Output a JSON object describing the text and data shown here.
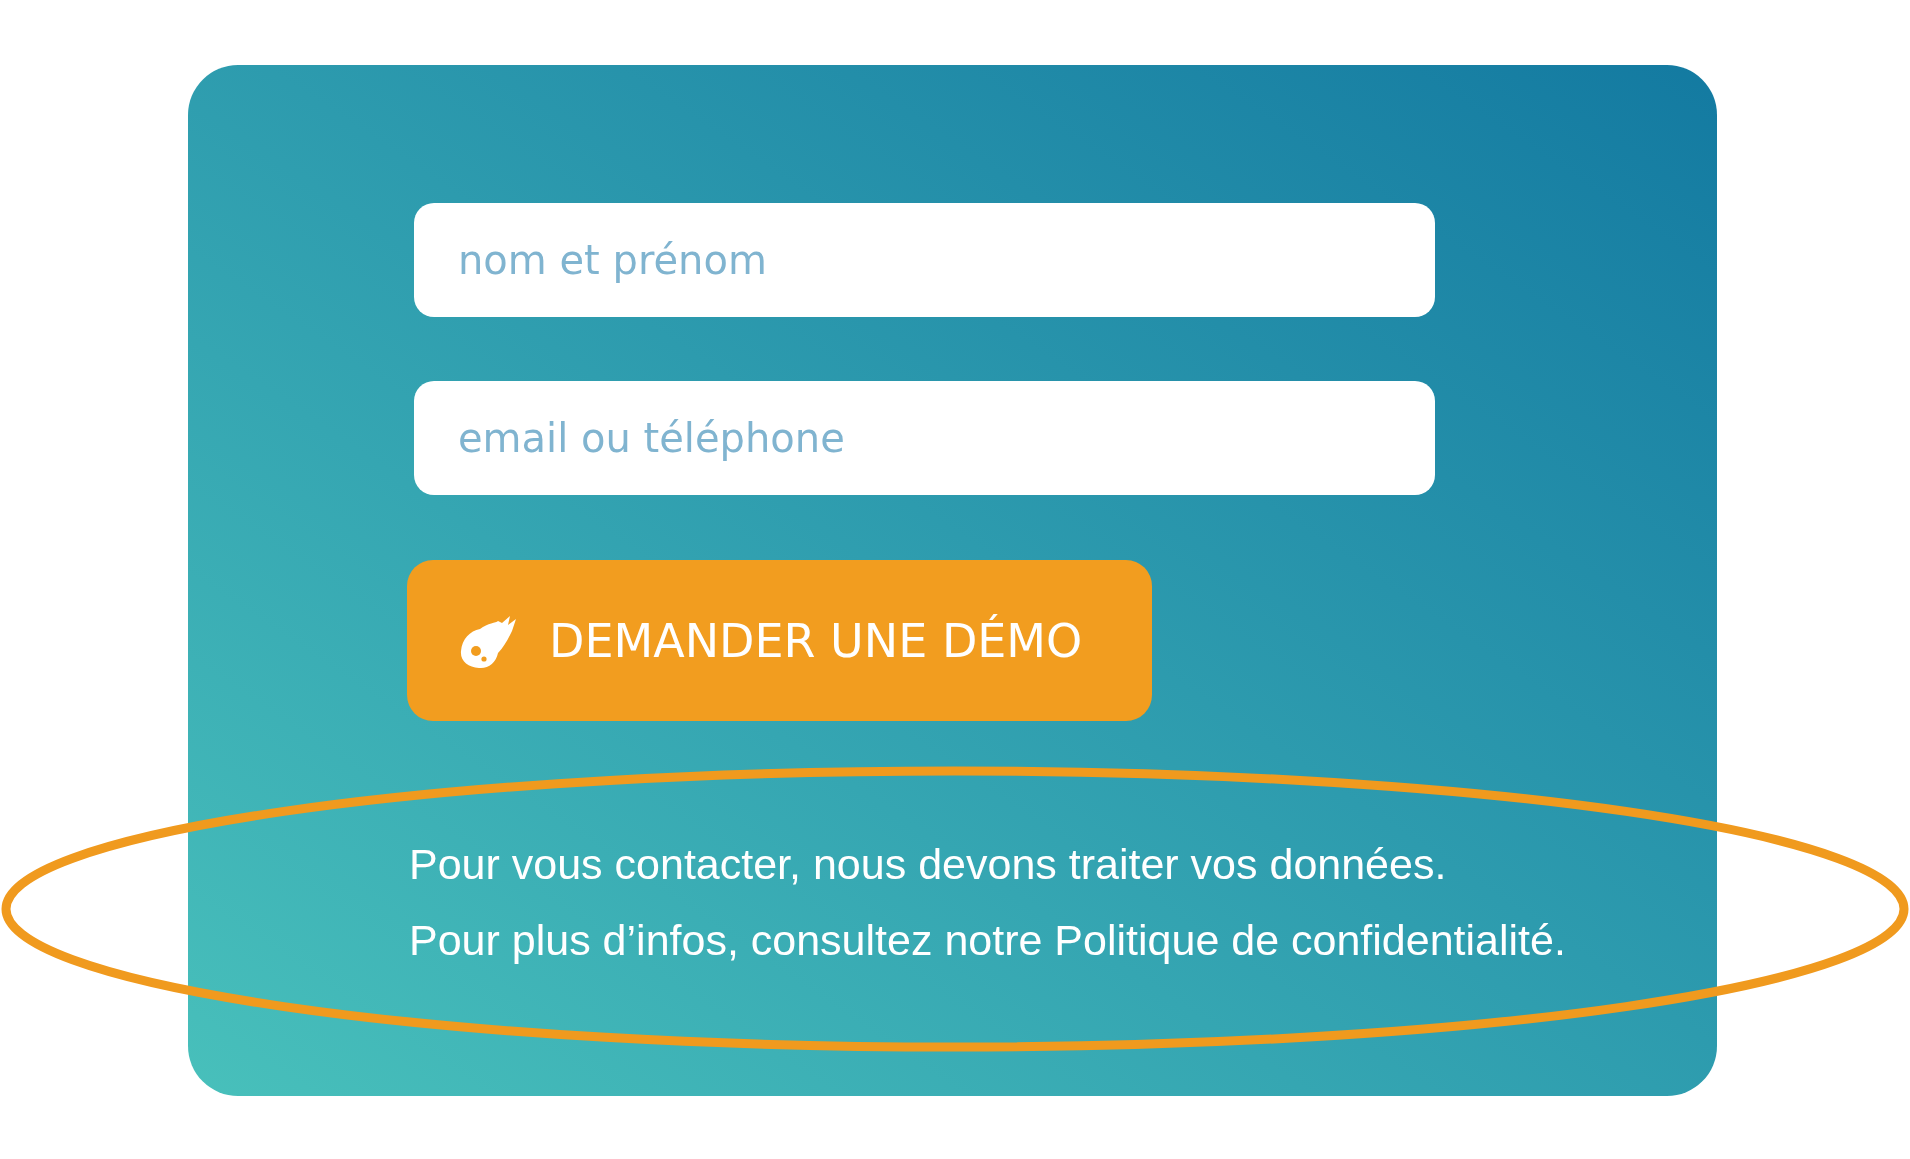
{
  "form": {
    "fields": [
      {
        "placeholder": "nom et prénom"
      },
      {
        "placeholder": "email ou téléphone"
      }
    ],
    "submit_button": {
      "label": "DEMANDER UNE DÉMO"
    },
    "notice": [
      "Pour vous contacter, nous devons traiter vos données.",
      "Pour plus d’infos, consultez notre Politique de confidentialité."
    ]
  }
}
